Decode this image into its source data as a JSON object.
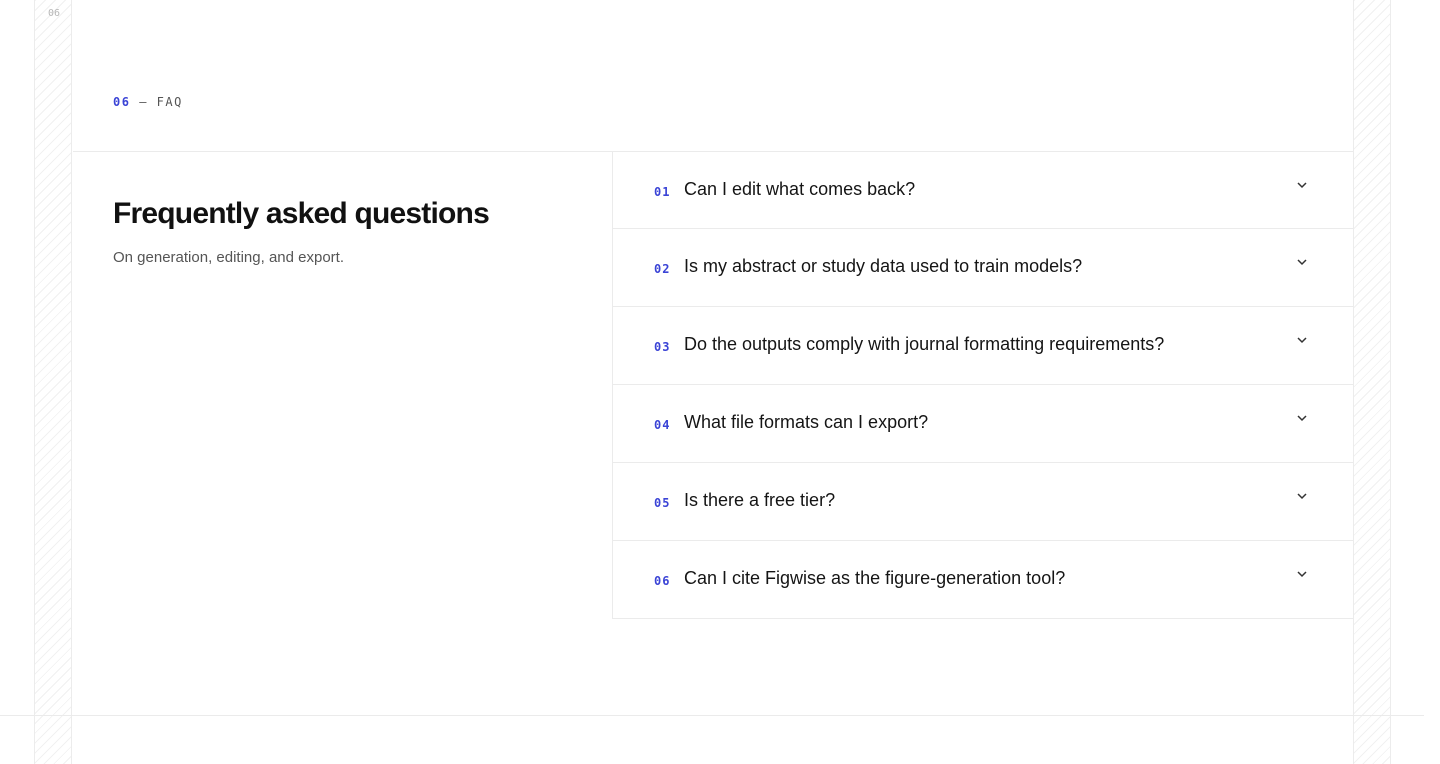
{
  "rail": {
    "section_number": "06"
  },
  "section": {
    "number": "06",
    "separator": "—",
    "label": "FAQ"
  },
  "title": "Frequently asked questions",
  "subtitle": "On generation, editing, and export.",
  "faq": [
    {
      "num": "01",
      "question": "Can I edit what comes back?"
    },
    {
      "num": "02",
      "question": "Is my abstract or study data used to train models?"
    },
    {
      "num": "03",
      "question": "Do the outputs comply with journal formatting requirements?"
    },
    {
      "num": "04",
      "question": "What file formats can I export?"
    },
    {
      "num": "05",
      "question": "Is there a free tier?"
    },
    {
      "num": "06",
      "question": "Can I cite Figwise as the figure-generation tool?"
    }
  ],
  "colors": {
    "accent": "#3b44d6",
    "text": "#151515",
    "muted": "#555555",
    "border": "#ebebeb"
  },
  "icons": {
    "expand": "chevron-down-icon"
  }
}
